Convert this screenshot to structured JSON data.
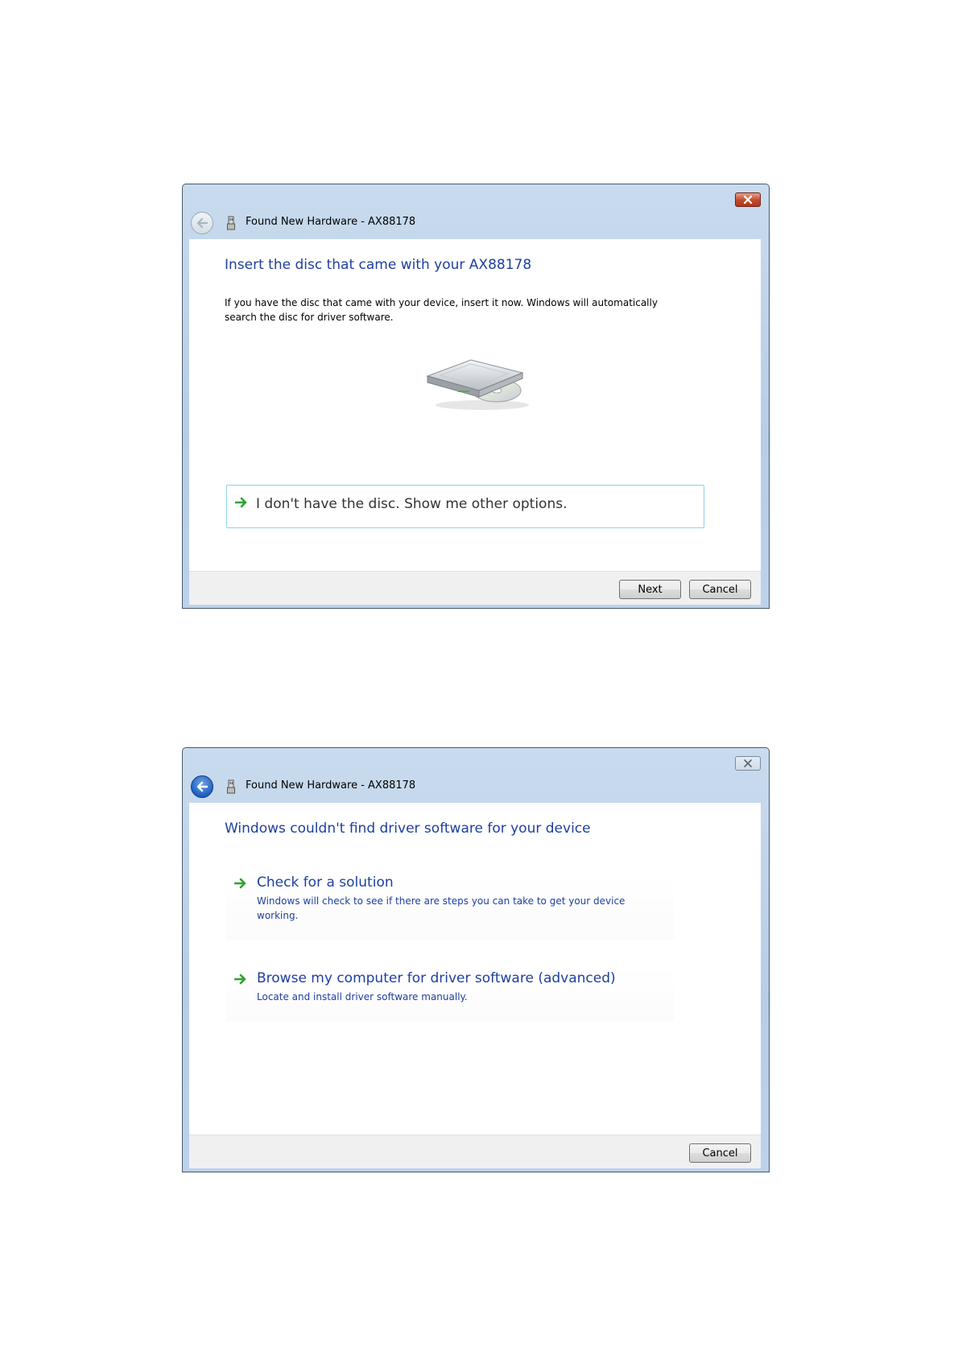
{
  "dialog_insert_disc": {
    "title": "Found New Hardware - AX88178",
    "heading": "Insert the disc that came with your AX88178",
    "body": "If you have the disc that came with your device, insert it now.  Windows will automatically search the disc for driver software.",
    "option_label": "I don't have the disc.  Show me other options.",
    "next_label": "Next",
    "cancel_label": "Cancel"
  },
  "dialog_no_driver": {
    "title": "Found New Hardware - AX88178",
    "heading": "Windows couldn't find driver software for your device",
    "options": [
      {
        "title": "Check for a solution",
        "description": "Windows will check to see if there are steps you can take to get your device working."
      },
      {
        "title": "Browse my computer for driver software (advanced)",
        "description": "Locate and install driver software manually."
      }
    ],
    "cancel_label": "Cancel"
  },
  "icons": {
    "back": "back-arrow-icon",
    "usb": "usb-device-icon",
    "close": "close-icon",
    "option_arrow": "green-arrow-icon",
    "disc": "disc-drive-icon"
  },
  "colors": {
    "heading": "#1e3f9e",
    "arrow": "#2ea32e",
    "close_active": "#c24a2a"
  }
}
